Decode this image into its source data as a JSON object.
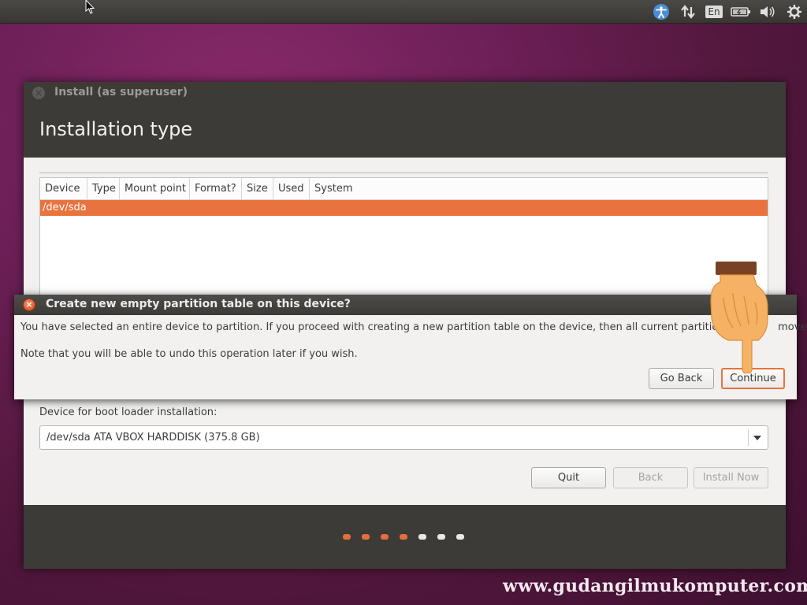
{
  "top_panel": {
    "icons": [
      "accessibility-icon",
      "network-icon",
      "keyboard-layout-icon",
      "battery-icon",
      "volume-icon",
      "settings-gear-icon"
    ],
    "keyboard_layout": "En"
  },
  "installer": {
    "window_title": "Install (as superuser)",
    "page_heading": "Installation type",
    "table": {
      "columns": [
        "Device",
        "Type",
        "Mount point",
        "Format?",
        "Size",
        "Used",
        "System"
      ],
      "rows": [
        {
          "device": "/dev/sda",
          "selected": true
        }
      ]
    },
    "boot_loader": {
      "label": "Device for boot loader installation:",
      "selected": "/dev/sda ATA VBOX HARDDISK (375.8 GB)"
    },
    "buttons": {
      "quit": "Quit",
      "back": "Back",
      "install_now": "Install Now"
    },
    "progress": {
      "completed_steps": 4,
      "total_steps": 7
    }
  },
  "dialog": {
    "title": "Create new empty partition table on this device?",
    "message_1": "You have selected an entire device to partition. If you proceed with creating a new partition table on the device, then all current partitions w",
    "message_1_end": "moved.",
    "message_2": "Note that you will be able to undo this operation later if you wish.",
    "buttons": {
      "go_back": "Go Back",
      "continue": "Continue"
    }
  },
  "watermark": "www.gudangilmukomputer.com",
  "colors": {
    "accent": "#e8733e",
    "panel": "#3c3b37",
    "background": "#6b1f55"
  }
}
